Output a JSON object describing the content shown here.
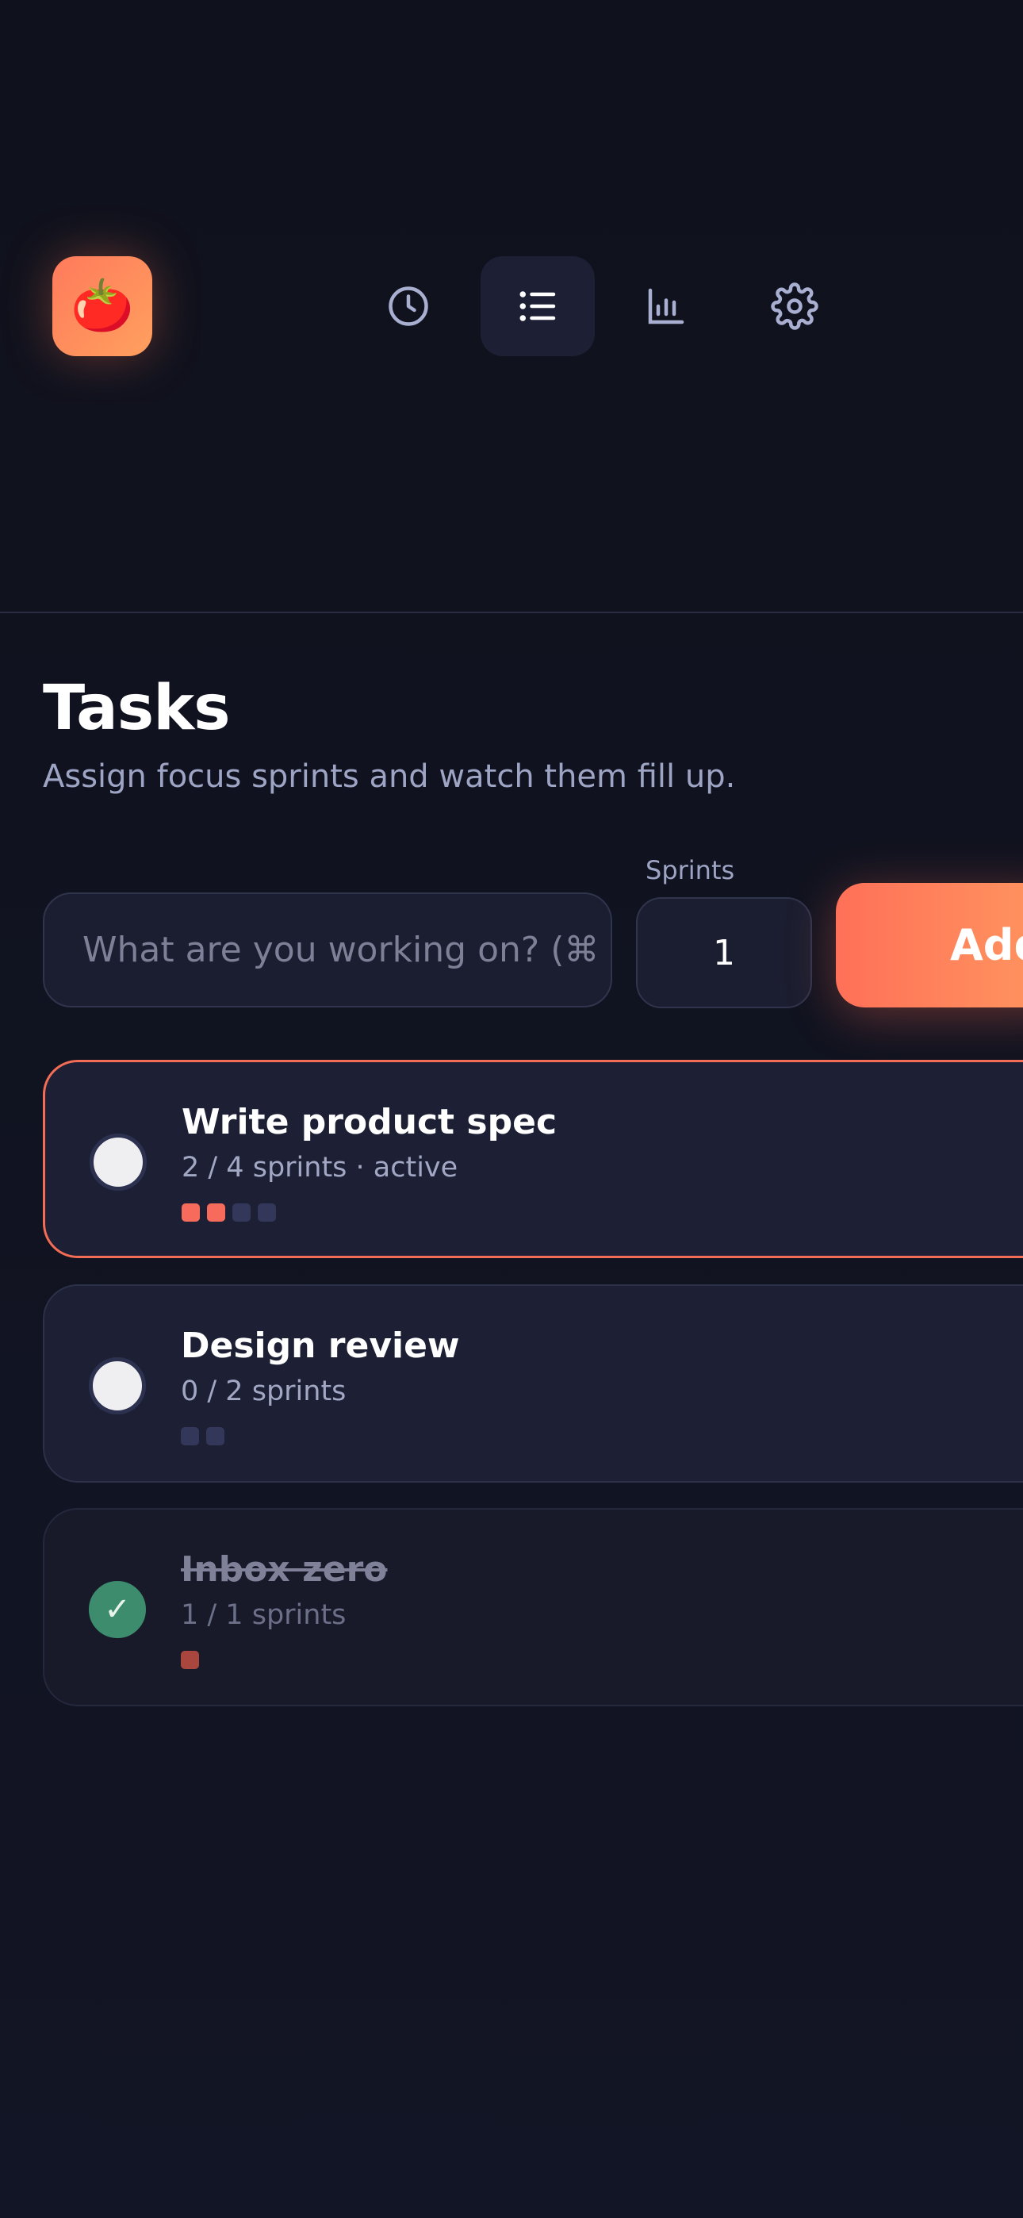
{
  "app": {
    "logo": "tomato-icon",
    "logo_glyph": "🍅"
  },
  "nav": {
    "items": [
      {
        "id": "timer",
        "icon": "clock-icon",
        "active": false
      },
      {
        "id": "tasks",
        "icon": "list-icon",
        "active": true
      },
      {
        "id": "stats",
        "icon": "bar-chart-icon",
        "active": false
      },
      {
        "id": "settings",
        "icon": "gear-icon",
        "active": false
      }
    ]
  },
  "header": {
    "title": "Tasks",
    "subtitle": "Assign focus sprints and watch them fill up."
  },
  "add_task": {
    "input_placeholder": "What are you working on? (⌘",
    "sprints_label": "Sprints",
    "sprints_value": "1",
    "add_label": "Add"
  },
  "tasks": [
    {
      "name": "Write product spec",
      "meta": "2 / 4 sprints · active",
      "completed": 2,
      "total": 4,
      "state": "active"
    },
    {
      "name": "Design review",
      "meta": "0 / 2 sprints",
      "completed": 0,
      "total": 2,
      "state": "todo"
    },
    {
      "name": "Inbox zero",
      "meta": "1 / 1 sprints",
      "completed": 1,
      "total": 1,
      "state": "done",
      "check_glyph": "✓"
    }
  ],
  "colors": {
    "accent": "#f66b5b",
    "accent_gradient_end": "#ff9a60",
    "done_green": "#3d8c6e",
    "background": "#0f111c",
    "card": "#1d2035"
  }
}
